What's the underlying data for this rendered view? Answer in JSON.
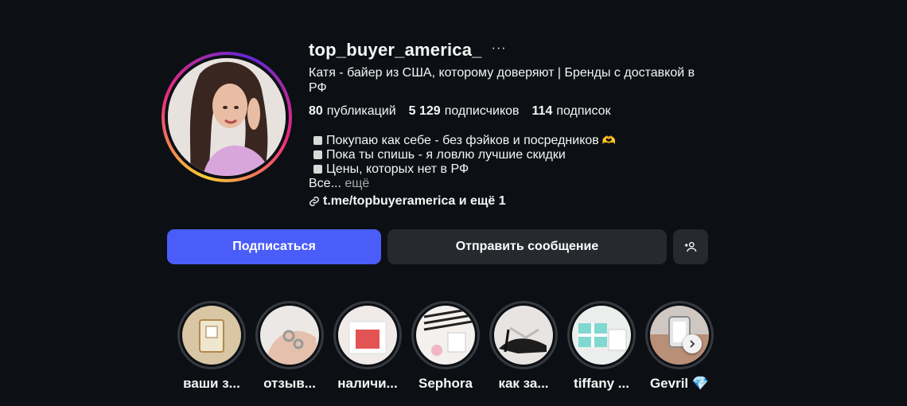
{
  "profile": {
    "username": "top_buyer_america_",
    "more_label": "···",
    "full_name": "Катя - байер из США, которому доверяют | Бренды с доставкой в РФ",
    "stats": [
      {
        "value": "80",
        "label": "публикаций"
      },
      {
        "value": "5 129",
        "label": "подписчиков"
      },
      {
        "value": "114",
        "label": "подписок"
      }
    ],
    "bio": [
      "Покупаю как себе - без фэйков и посредников",
      "Пока ты спишь - я ловлю лучшие скидки",
      "Цены, которых нет в РФ"
    ],
    "bio_emoji": "🫶",
    "bio_truncated": "Все...",
    "bio_more": "ещё",
    "link": "t.me/topbuyeramerica и ещё 1"
  },
  "actions": {
    "follow": "Подписаться",
    "message": "Отправить сообщение"
  },
  "highlights": [
    {
      "label": "ваши з..."
    },
    {
      "label": "отзыв..."
    },
    {
      "label": "наличи..."
    },
    {
      "label": "Sephora"
    },
    {
      "label": "как за..."
    },
    {
      "label": "tiffany ..."
    },
    {
      "label": "Gevril 💎"
    }
  ],
  "colors": {
    "background": "#0c1014",
    "follow_button": "#4a5df9",
    "secondary_button": "#26292e"
  }
}
